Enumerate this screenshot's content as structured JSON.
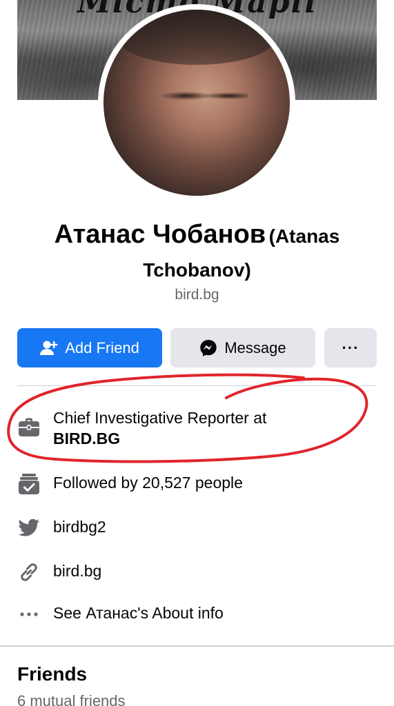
{
  "cover": {
    "text": "Місто Марії"
  },
  "profile": {
    "name": "Атанас Чобанов",
    "name_alt": "(Atanas Tchobanov)",
    "subtitle": "bird.bg"
  },
  "actions": {
    "add_friend": "Add Friend",
    "message": "Message",
    "more": "···"
  },
  "info": {
    "work_prefix": "Chief Investigative Reporter at",
    "work_org": "BIRD.BG",
    "followers": "Followed by 20,527 people",
    "twitter": "birdbg2",
    "website": "bird.bg",
    "about": "See Атанас's About info"
  },
  "friends": {
    "title": "Friends",
    "mutual": "6 mutual friends"
  },
  "icons": {
    "work": "briefcase-icon",
    "followers": "followers-check-icon",
    "twitter": "twitter-bird-icon",
    "website": "link-icon",
    "about": "ellipsis-icon"
  },
  "colors": {
    "primary": "#1877f2",
    "secondary_button": "#e4e6eb",
    "icon_gray": "#65676b",
    "annotation_red": "#e0252b"
  }
}
